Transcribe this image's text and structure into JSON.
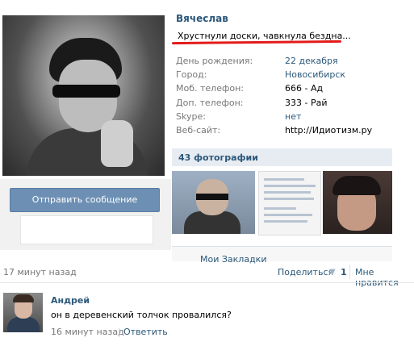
{
  "profile": {
    "name": "Вячеслав",
    "status": "Хрустнули доски, чавкнула бездна...",
    "fields": [
      {
        "label": "День рождения:",
        "value": "22 декабря",
        "link": true
      },
      {
        "label": "Город:",
        "value": "Новосибирск",
        "link": true
      },
      {
        "label": "Моб. телефон:",
        "value": "666 - Ад",
        "link": false
      },
      {
        "label": "Доп. телефон:",
        "value": "333 - Рай",
        "link": false
      },
      {
        "label": "Skype:",
        "value": "нет",
        "link": true
      },
      {
        "label": "Веб-сайт:",
        "value": "http://Идиотизм.ру",
        "link": false
      }
    ],
    "send_message_label": "Отправить сообщение",
    "photos_title": "43 фотографии",
    "bookmarks_label": "Мои Закладки"
  },
  "post": {
    "time": "17 минут назад",
    "share_label": "Поделиться",
    "share_count": "1",
    "like_label": "Мне нравится"
  },
  "comment": {
    "author": "Андрей",
    "text": "он в деревенский толчок провалился?",
    "time": "16 минут назад",
    "separator": "|",
    "reply_label": "Ответить"
  },
  "colors": {
    "link": "#2b587a",
    "button": "#6d8fb3",
    "highlight": "#e31b1b"
  },
  "icons": {
    "share": "megaphone-icon"
  }
}
